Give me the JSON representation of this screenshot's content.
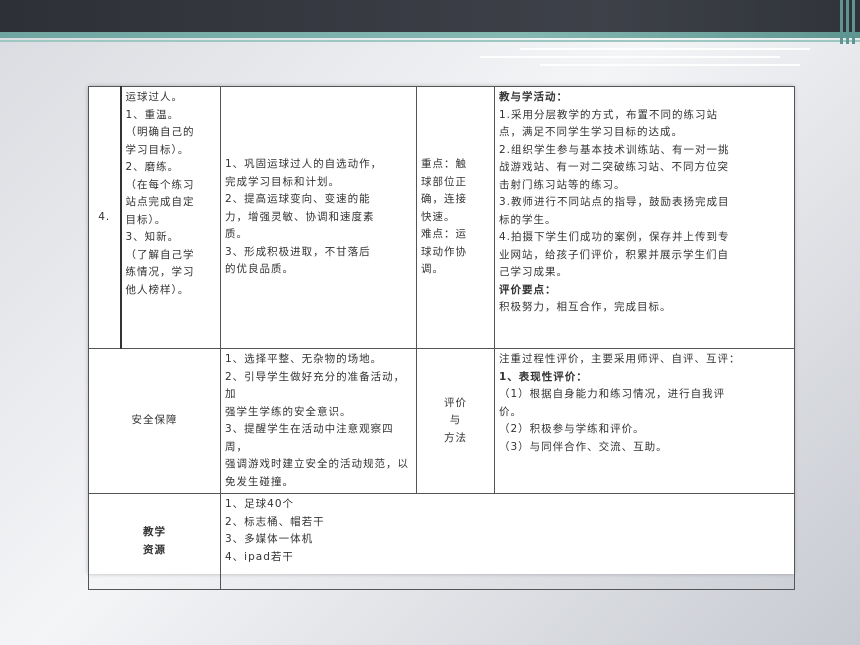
{
  "table": {
    "row1": {
      "num": "4.",
      "content_lines": [
        "运球过人。",
        "1、重温。",
        "（明确自己的",
        "学习目标）。",
        "2、磨练。",
        "（在每个练习",
        "站点完成自定",
        "目标）。",
        "3、知新。",
        "（了解自己学",
        "练情况，学习",
        "他人榜样）。",
        "",
        ""
      ],
      "goals_lines": [
        "1、巩固运球过人的自选动作，",
        "完成学习目标和计划。",
        "2、提高运球变向、变速的能",
        "力，增强灵敏、协调和速度素",
        "质。",
        "3、形成积极进取，不甘落后",
        "的优良品质。"
      ],
      "key_lines": [
        "重点：触",
        "球部位正",
        "确，连接",
        "快速。",
        "",
        "难点：运",
        "球动作协",
        "调。"
      ],
      "activity_title": "教与学活动：",
      "activity_lines": [
        "1.采用分层教学的方式，布置不同的练习站",
        "点，满足不同学生学习目标的达成。",
        "2.组织学生参与基本技术训练站、有一对一挑",
        "战游戏站、有一对二突破练习站、不同方位突",
        "击射门练习站等的练习。",
        "3.教师进行不同站点的指导，鼓励表扬完成目",
        "标的学生。",
        "4.拍摄下学生们成功的案例，保存并上传到专",
        "业网站，给孩子们评价，积累并展示学生们自",
        "己学习成果。",
        ""
      ],
      "eval_title": "评价要点：",
      "eval_line": "积极努力，相互合作，完成目标。"
    },
    "row2": {
      "label": "安全保障",
      "content_lines": [
        "1、选择平整、无杂物的场地。",
        "2、引导学生做好充分的准备活动，加",
        "强学生学练的安全意识。",
        "3、提醒学生在活动中注意观察四周，",
        "强调游戏时建立安全的活动规范，以",
        "免发生碰撞。"
      ],
      "method_lines": [
        "评价",
        "与",
        "方法"
      ],
      "right_lines": [
        "注重过程性评价，主要采用师评、自评、互评：",
        "1、表现性评价：",
        "（1）根据自身能力和练习情况，进行自我评",
        "价。",
        "（2）积极参与学练和评价。",
        "（3）与同伴合作、交流、互助。",
        ""
      ]
    },
    "row3": {
      "label_lines": [
        "教学",
        "资源"
      ],
      "content_lines": [
        "1、足球40个",
        "2、标志桶、帽若干",
        "3、多媒体一体机",
        "4、ipad若干",
        ""
      ]
    }
  }
}
